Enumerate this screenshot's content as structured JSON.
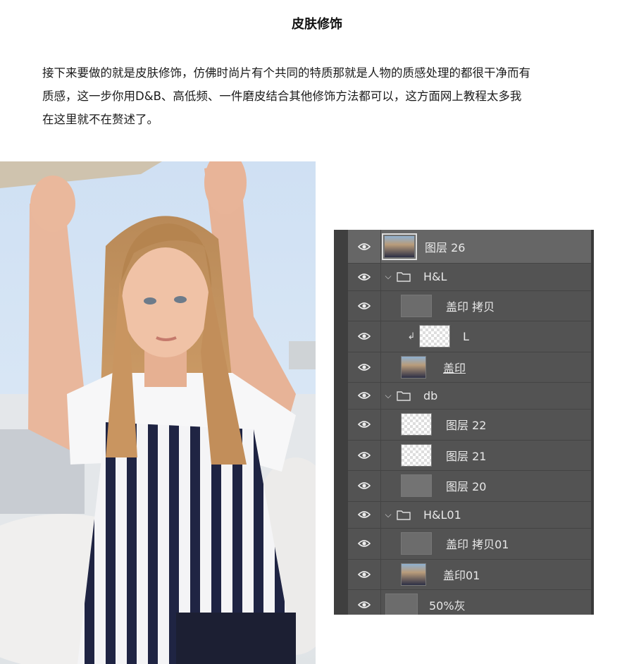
{
  "article": {
    "title": "皮肤修饰",
    "paragraph_lines": [
      "接下来要做的就是皮肤修饰，仿佛时尚片有个共同的特质那就是人物的质感处理的都很干净而有",
      "质感，这一步你用D&B、高低频、一件磨皮结合其他修饰方法都可以，这方面网上教程太多我",
      "在这里就不在赘述了。"
    ]
  },
  "layers_panel": {
    "layers": [
      {
        "name": "图层 26",
        "thumb": "photo",
        "indent": 0,
        "selected": true
      },
      {
        "name": "H&L",
        "thumb": "folder",
        "indent": 0,
        "group": true
      },
      {
        "name": "盖印 拷贝",
        "thumb": "gray",
        "indent": 1
      },
      {
        "name": "L",
        "thumb": "check",
        "indent": 1,
        "clipped": true
      },
      {
        "name": "盖印",
        "thumb": "photo",
        "indent": 1,
        "underline": true
      },
      {
        "name": "db",
        "thumb": "folder",
        "indent": 0,
        "group": true
      },
      {
        "name": "图层 22",
        "thumb": "check",
        "indent": 1
      },
      {
        "name": "图层 21",
        "thumb": "check",
        "indent": 1
      },
      {
        "name": "图层 20",
        "thumb": "gray2",
        "indent": 1
      },
      {
        "name": "H&L01",
        "thumb": "folder",
        "indent": 0,
        "group": true
      },
      {
        "name": "盖印 拷贝01",
        "thumb": "gray",
        "indent": 1
      },
      {
        "name": "盖印01",
        "thumb": "photo",
        "indent": 1
      },
      {
        "name": "50%灰",
        "thumb": "gray",
        "indent": 0
      }
    ],
    "colors": {
      "panel_bg": "#535353",
      "selected_bg": "#666666",
      "text": "#e8e8e8"
    }
  },
  "icons": {
    "visibility": "eye-icon",
    "group": "folder-icon",
    "expand": "chevron-down-icon",
    "clip": "clipping-arrow-icon"
  }
}
